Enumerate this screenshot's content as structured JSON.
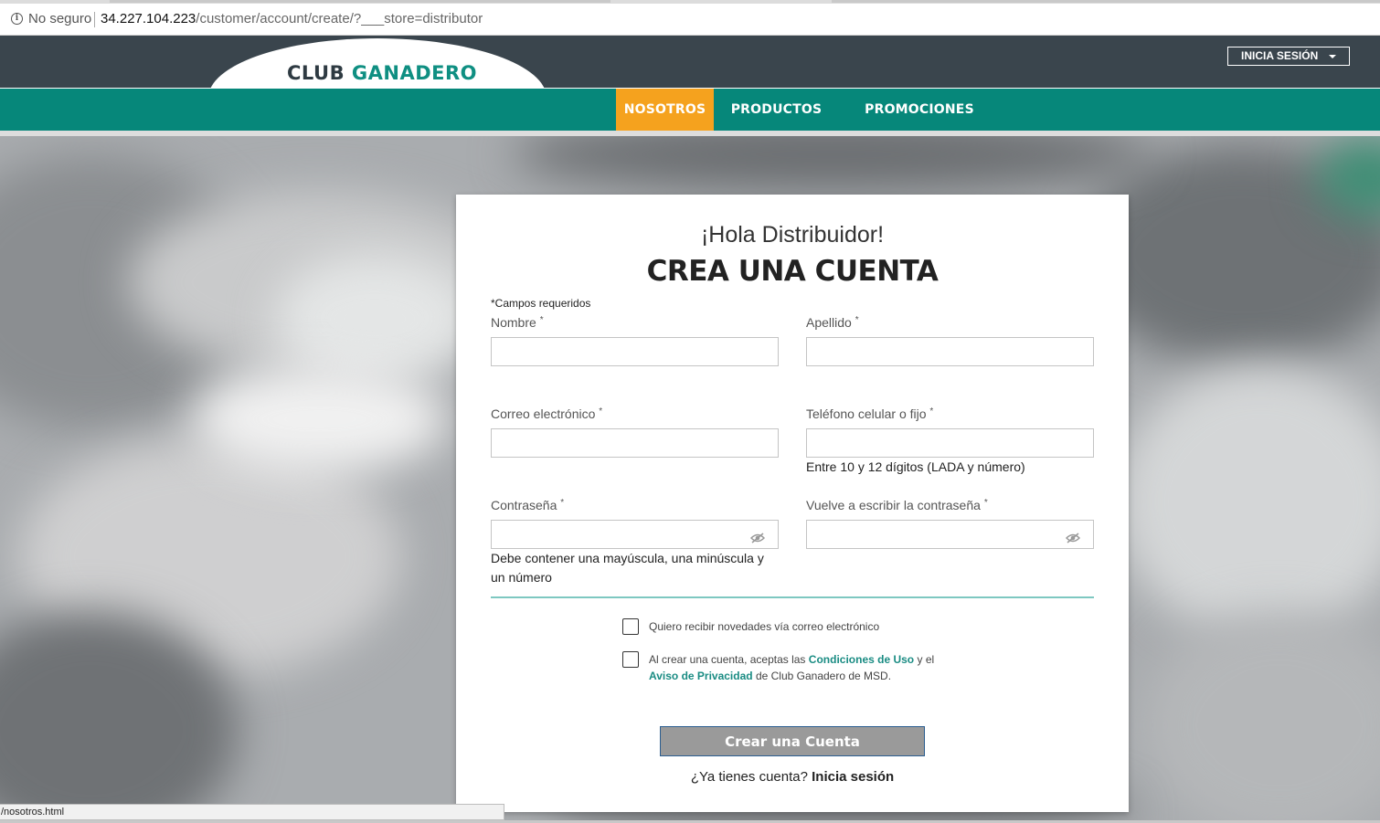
{
  "browser": {
    "security_label": "No seguro",
    "url_host": "34.227.104.223",
    "url_path": "/customer/account/create/?___store=distributor",
    "status_text": "/nosotros.html"
  },
  "header": {
    "logo_club": "CLUB",
    "logo_ganadero": "GANADERO",
    "login_button": "INICIA SESIÓN",
    "nav": [
      {
        "label": "NOSOTROS",
        "active": true
      },
      {
        "label": "PRODUCTOS",
        "active": false
      },
      {
        "label": "PROMOCIONES",
        "active": false
      }
    ]
  },
  "form": {
    "greeting": "¡Hola Distribuidor!",
    "title": "CREA UNA CUENTA",
    "required_note": "*Campos requeridos",
    "required_mark": "*",
    "fields": {
      "first_name": {
        "label": "Nombre",
        "value": ""
      },
      "last_name": {
        "label": "Apellido",
        "value": ""
      },
      "email": {
        "label": "Correo electrónico",
        "value": ""
      },
      "phone": {
        "label": "Teléfono celular o fijo",
        "value": "",
        "hint": "Entre 10 y 12 dígitos (LADA y número)"
      },
      "password": {
        "label": "Contraseña",
        "value": "",
        "hint": "Debe contener una mayúscula, una minúscula y un número"
      },
      "password_confirm": {
        "label": "Vuelve a escribir la contraseña",
        "value": ""
      }
    },
    "newsletter_label": "Quiero recibir novedades vía correo electrónico",
    "terms": {
      "prefix": "Al crear una cuenta, aceptas las",
      "terms_link": "Condiciones de Uso",
      "middle": "y el",
      "privacy_link": "Aviso de Privacidad",
      "suffix": "de Club Ganadero de MSD."
    },
    "submit_label": "Crear una Cuenta",
    "have_account_prompt": "¿Ya tienes cuenta?",
    "login_link": "Inicia sesión"
  },
  "colors": {
    "header_dark": "#3a454d",
    "nav_teal": "#06877a",
    "nav_active": "#f5a21e",
    "link_teal": "#1a8c83",
    "button_gray": "#9a9a9a"
  },
  "icons": [
    "info-icon",
    "chevron-down-icon",
    "eye-off-icon"
  ]
}
